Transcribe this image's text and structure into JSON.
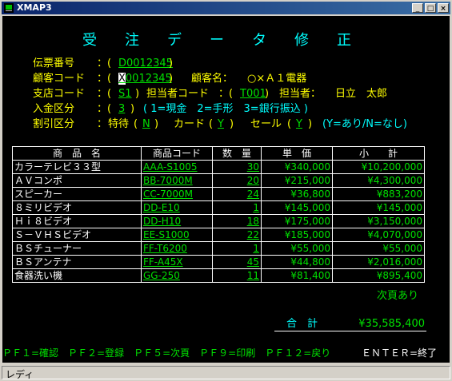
{
  "window": {
    "title": "XMAP3"
  },
  "screen": {
    "title_chars": [
      "受",
      "注",
      "デ",
      "ー",
      "タ",
      "修",
      "正"
    ],
    "fields": {
      "denpyo_label": "伝票番号",
      "denpyo_value": "D0012345",
      "kokyaku_label": "顧客コード",
      "kokyaku_value": "X0012345",
      "kokyaku_name_label": "顧客名：",
      "kokyaku_name_value": "○×Ａ１電器",
      "shiten_label": "支店コード",
      "shiten_value": "S1",
      "tanto_code_label": "担当者コード",
      "tanto_code_value": "T001",
      "tanto_label": "担当者：",
      "tanto_value": "日立　太郎",
      "nyukin_label": "入金区分",
      "nyukin_value": "3",
      "nyukin_options": "( 1=現金　2=手形　3=銀行振込 )",
      "waribiki_label": "割引区分",
      "tokutai_label": "特待",
      "tokutai_value": "N",
      "card_label": "カード",
      "card_value": "Y",
      "sale_label": "セール",
      "sale_value": "Y",
      "yn_hint": "(Y=あり/N=なし)"
    },
    "table": {
      "headers": [
        "商　品　名",
        "商品コード",
        "数　量",
        "単　価",
        "小　　計"
      ],
      "rows": [
        {
          "name": "カラーテレビ３３型",
          "code": "AAA-S1005",
          "qty": "30",
          "price": "¥340,000",
          "subtotal": "¥10,200,000"
        },
        {
          "name": "ＡＶコンポ",
          "code": "BB-7000M",
          "qty": "20",
          "price": "¥215,000",
          "subtotal": "¥4,300,000"
        },
        {
          "name": "スピーカー",
          "code": "CC-7000M",
          "qty": "24",
          "price": "¥36,800",
          "subtotal": "¥883,200"
        },
        {
          "name": "８ミリビデオ",
          "code": "DD-E10",
          "qty": "1",
          "price": "¥145,000",
          "subtotal": "¥145,000"
        },
        {
          "name": "Ｈｉ８ビデオ",
          "code": "DD-H10",
          "qty": "18",
          "price": "¥175,000",
          "subtotal": "¥3,150,000"
        },
        {
          "name": "Ｓ－ＶＨＳビデオ",
          "code": "EE-S1000",
          "qty": "22",
          "price": "¥185,000",
          "subtotal": "¥4,070,000"
        },
        {
          "name": "ＢＳチューナー",
          "code": "FF-T6200",
          "qty": "1",
          "price": "¥55,000",
          "subtotal": "¥55,000"
        },
        {
          "name": "ＢＳアンテナ",
          "code": "FF-A45X",
          "qty": "45",
          "price": "¥44,800",
          "subtotal": "¥2,016,000"
        },
        {
          "name": "食器洗い機",
          "code": "GG-250",
          "qty": "11",
          "price": "¥81,400",
          "subtotal": "¥895,400"
        }
      ]
    },
    "next_page": "次頁あり",
    "total_label": "合　計",
    "total_value": "¥35,585,400",
    "function_keys": "ＰＦ１=確認　ＰＦ２=登録　ＰＦ５=次頁　ＰＦ９=印刷　ＰＦ１２=戻り",
    "enter_key": "ＥＮＴＥＲ=終了"
  },
  "status": {
    "text": "レディ"
  },
  "colors": {
    "bg": "#000000",
    "label": "#ffff00",
    "value": "#00e000",
    "accent": "#00ffff",
    "titlebar": "#0a246a"
  }
}
